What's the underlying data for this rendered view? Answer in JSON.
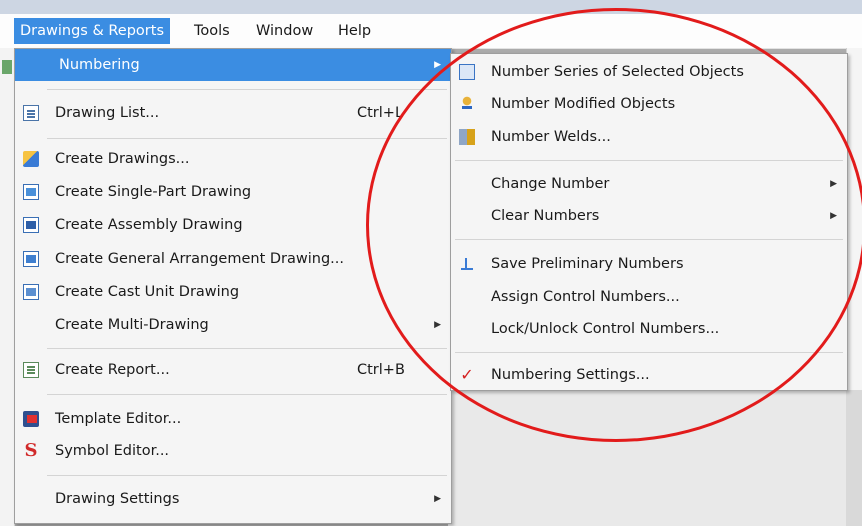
{
  "menubar": {
    "items": [
      {
        "label": "Drawings & Reports",
        "active": true
      },
      {
        "label": "Tools"
      },
      {
        "label": "Window"
      },
      {
        "label": "Help"
      }
    ]
  },
  "main_menu": {
    "items": [
      {
        "label": "Numbering",
        "highlighted": true,
        "submenu": true
      },
      {
        "label": "Drawing List...",
        "shortcut": "Ctrl+L",
        "icon": "drawing-list-icon"
      },
      {
        "label": "Create Drawings...",
        "icon": "create-drawings-icon"
      },
      {
        "label": "Create Single-Part Drawing",
        "icon": "single-part-drawing-icon"
      },
      {
        "label": "Create Assembly Drawing",
        "icon": "assembly-drawing-icon"
      },
      {
        "label": "Create General Arrangement Drawing...",
        "icon": "ga-drawing-icon"
      },
      {
        "label": "Create Cast Unit Drawing",
        "icon": "cast-unit-drawing-icon"
      },
      {
        "label": "Create Multi-Drawing",
        "submenu": true
      },
      {
        "label": "Create Report...",
        "shortcut": "Ctrl+B",
        "icon": "report-icon"
      },
      {
        "label": "Template Editor...",
        "icon": "template-editor-icon"
      },
      {
        "label": "Symbol Editor...",
        "icon": "symbol-editor-icon"
      },
      {
        "label": "Drawing Settings",
        "submenu": true
      }
    ]
  },
  "numbering_menu": {
    "items": [
      {
        "label": "Number Series of Selected Objects",
        "icon": "number-series-icon"
      },
      {
        "label": "Number Modified Objects",
        "icon": "number-modified-icon"
      },
      {
        "label": "Number Welds...",
        "icon": "number-welds-icon"
      },
      {
        "label": "Change Number",
        "submenu": true
      },
      {
        "label": "Clear Numbers",
        "submenu": true
      },
      {
        "label": "Save Preliminary Numbers",
        "icon": "save-preliminary-icon"
      },
      {
        "label": "Assign Control Numbers..."
      },
      {
        "label": "Lock/Unlock Control Numbers..."
      },
      {
        "label": "Numbering Settings...",
        "icon": "numbering-settings-icon"
      }
    ]
  },
  "colors": {
    "highlight": "#3b8de2",
    "annotation_circle": "#e21b1b"
  }
}
